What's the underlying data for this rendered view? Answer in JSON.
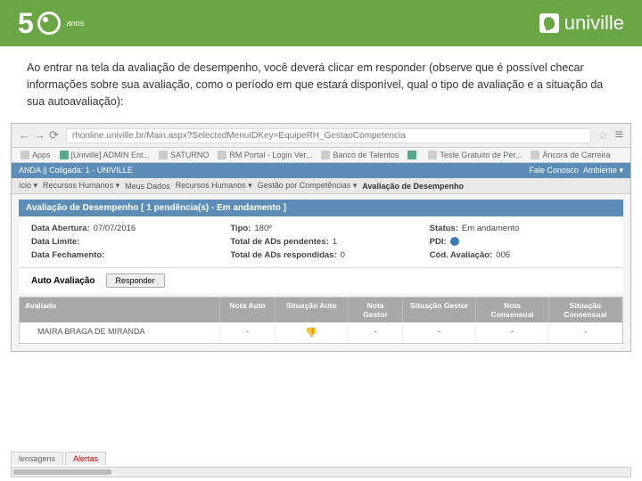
{
  "header": {
    "anos": "anos",
    "brand": "univille"
  },
  "instruction": "Ao entrar na tela da avaliação de desempenho, você deverá clicar em responder (observe que é possível checar informações sobre sua avaliação, como o período em que estará disponível, qual o tipo de avaliação e a situação da sua autoavaliação):",
  "browser": {
    "url": "rhonline.univille.br/Main.aspx?SelectedMenuIDKey=EquipeRH_GestaoCompetencia",
    "bookmarks": [
      "Apps",
      "[Univille] ADMIN Ent...",
      "SATURNO",
      "RM Portal - Login Ver...",
      "Banco de Talentos",
      "",
      "Teste Gratuito de Per...",
      "Âncora de Carreira"
    ]
  },
  "topbar": {
    "left": "ANDA || Coligada: 1 - UNIVILLE",
    "right1": "Fale Conosco",
    "right2": "Ambiente"
  },
  "breadcrumb": {
    "b1": "ício ▾",
    "b2": "Recursos Humanos ▾",
    "b3": "Meus Dados",
    "b4": "Recursos Humanos ▾",
    "b5": "Gestão por Competências ▾",
    "b6": "Avaliação de Desempenho"
  },
  "section": {
    "title": "Avaliação de Desempenho [ 1 pendência(s) - Em andamento ]"
  },
  "info": {
    "dataAbertLabel": "Data Abertura:",
    "dataAbert": "07/07/2016",
    "tipoLabel": "Tipo:",
    "tipo": "180º",
    "statusLabel": "Status:",
    "status": "Em andamento",
    "dataLimLabel": "Data Limite:",
    "pendLabel": "Total de ADs pendentes:",
    "pend": "1",
    "pdiLabel": "PDI:",
    "dataFechLabel": "Data Fechamento:",
    "respLabel": "Total de ADs respondidas:",
    "resp": "0",
    "codLabel": "Cód. Avaliação:",
    "cod": "006"
  },
  "autoRow": {
    "label": "Auto Avaliação",
    "btn": "Responder"
  },
  "table": {
    "headers": {
      "h1": "Avaliado",
      "h2": "Nota Auto",
      "h3": "Situação Auto",
      "h4": "Nota Gestor",
      "h5": "Situação Gestor",
      "h6": "Nota Consensual",
      "h7": "Situação Consensual"
    },
    "row": {
      "name": "MAIRA BRAGA DE MIRANDA",
      "c2": "-",
      "c4": "-",
      "c5": "-",
      "c6": "-",
      "c7": "-"
    }
  },
  "footer": {
    "t1": "lensagens",
    "t2": "Alertas"
  }
}
